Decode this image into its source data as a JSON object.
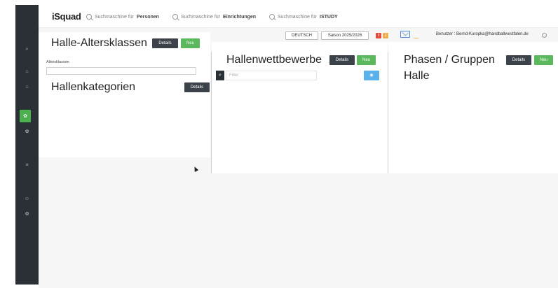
{
  "header": {
    "logo": "iSquad",
    "search_persons_prefix": "Suchmaschine für",
    "search_persons_bold": "Personen",
    "search_orgs_prefix": "Suchmaschine für",
    "search_orgs_bold": "Einrichtungen",
    "search_study_prefix": "Suchmaschine für",
    "search_study_bold": "ISTUDY"
  },
  "toolbar": {
    "language": "DEUTSCH",
    "season": "Saison 2025/2026",
    "badge_red": "3",
    "badge_orange": "1",
    "mail_label": "Neu",
    "user": "Benutzer : Bernd-Kuropka@handballwestfalen.de"
  },
  "panel_left": {
    "title": "Halle-Altersklassen",
    "details": "Details",
    "new": "Neu",
    "field_label": "Altersklassen",
    "subtitle": "Hallenkategorien",
    "sub_details": "Details"
  },
  "panel_mid": {
    "title": "Hallenwettbewerbe",
    "details": "Details",
    "new": "Neu",
    "filter_placeholder": "Filter"
  },
  "panel_right": {
    "title_line1": "Phasen / Gruppen",
    "title_line2": "Halle",
    "details": "Details",
    "new": "Neu"
  },
  "colors": {
    "sidebar": "#2b3037",
    "accent_green": "#5cb85c",
    "dark_button": "#3c4249",
    "badge_red": "#e04b3b",
    "badge_orange": "#f0ad4e"
  },
  "icons": {
    "search": "search-icon",
    "mail": "mail-icon",
    "eye": "eye-icon",
    "settings": "gear-icon"
  }
}
